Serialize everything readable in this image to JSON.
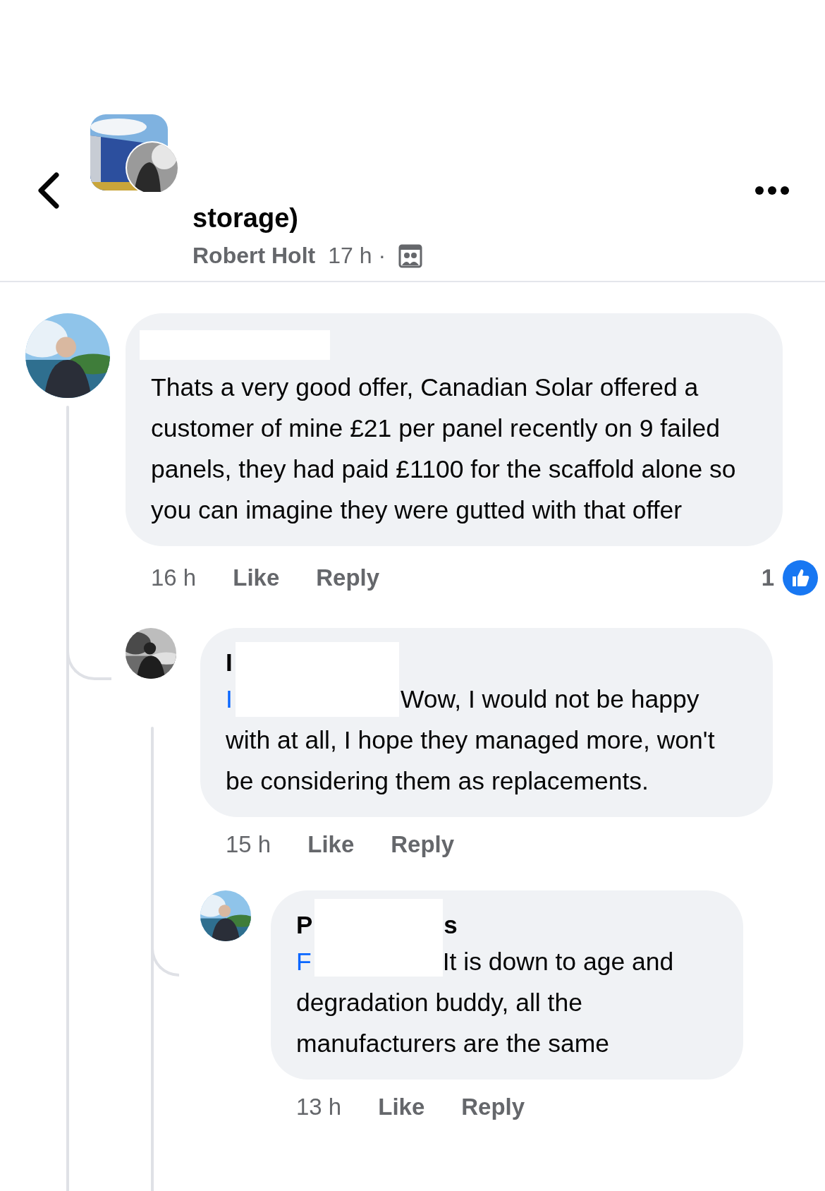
{
  "header": {
    "title": "storage)",
    "author": "Robert Holt",
    "time": "17 h ·"
  },
  "comments": [
    {
      "redacted": true,
      "text": "Thats a very good offer, Canadian Solar offered a customer of mine £21 per panel recently on 9 failed panels, they had paid £1100 for the scaffold alone so you can imagine they were gutted with that offer",
      "time": "16 h",
      "like": "Like",
      "reply": "Reply",
      "reactions": "1",
      "children": [
        {
          "author_start": "I",
          "redacted": true,
          "mention": "I",
          "text": "Wow, I would not be happy with at all, I hope they managed more, won't be considering them as replacements.",
          "time": "15 h",
          "like": "Like",
          "reply": "Reply",
          "children": [
            {
              "author_start": "P",
              "author_end": "s",
              "redacted": true,
              "mention": "F",
              "text": "It is down to age and degradation buddy, all the manufacturers are the same",
              "time": "13 h",
              "like": "Like",
              "reply": "Reply"
            }
          ]
        }
      ]
    }
  ]
}
